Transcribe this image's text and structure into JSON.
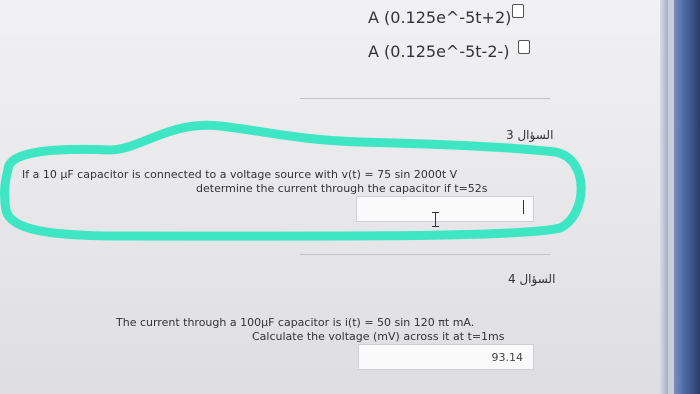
{
  "options": [
    {
      "label": "A (0.125e^-5t+2)"
    },
    {
      "label": "A (0.125e^-5t-2-)"
    }
  ],
  "question3": {
    "number_label": "السؤال 3",
    "line1": "If a 10 µF capacitor is connected to a voltage source with v(t) = 75 sin 2000t V",
    "line2": "determine the current through the capacitor if t=52s",
    "answer_value": ""
  },
  "question4": {
    "number_label": "السؤال 4",
    "line1": "The current through a 100µF capacitor is i(t) = 50 sin 120 πt mA.",
    "line2": "Calculate the voltage (mV) across it at t=1ms",
    "answer_value": "93.14"
  },
  "colors": {
    "highlight": "#3fe6c3"
  }
}
